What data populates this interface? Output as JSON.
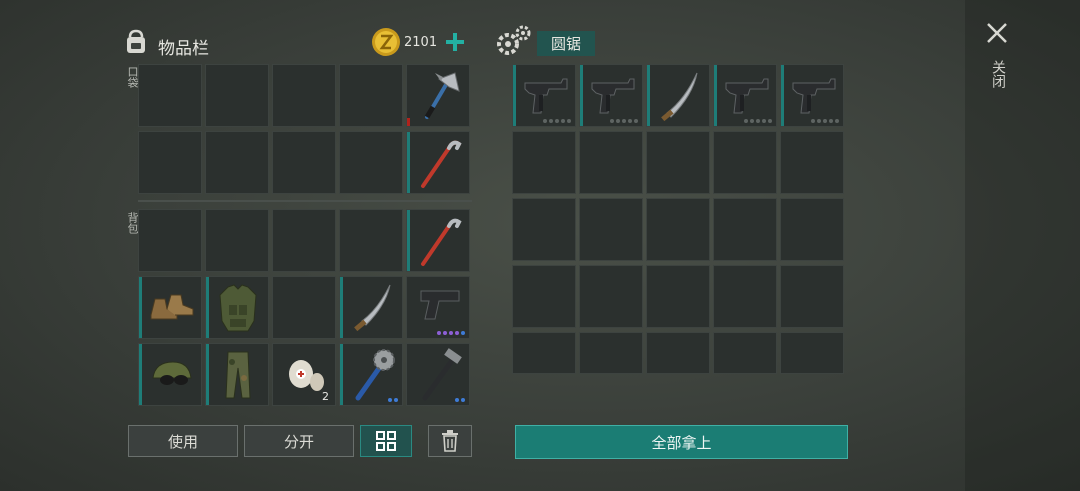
{
  "inventory": {
    "title": "物品栏",
    "coins": "2101",
    "pocket_label": "口袋",
    "backpack_label": "背包",
    "quantities": {
      "bandage": "2"
    }
  },
  "container": {
    "title": "圆锯"
  },
  "close": {
    "label": "关闭"
  },
  "buttons": {
    "use": "使用",
    "split": "分开",
    "take_all": "全部拿上"
  },
  "colors": {
    "accent": "#1e7d78",
    "take_all_bg": "#1b7d74",
    "coin": "#e0b730",
    "plus": "#23b0a3",
    "rarity_blue": "#3e7bd6",
    "rarity_purple": "#8d5fd6"
  },
  "icons": {
    "backpack": "backpack-icon",
    "coin": "coin-icon",
    "add": "plus-icon",
    "gears": "gears-icon",
    "close": "close-icon",
    "sort": "sort-grid-icon",
    "trash": "trash-icon"
  }
}
